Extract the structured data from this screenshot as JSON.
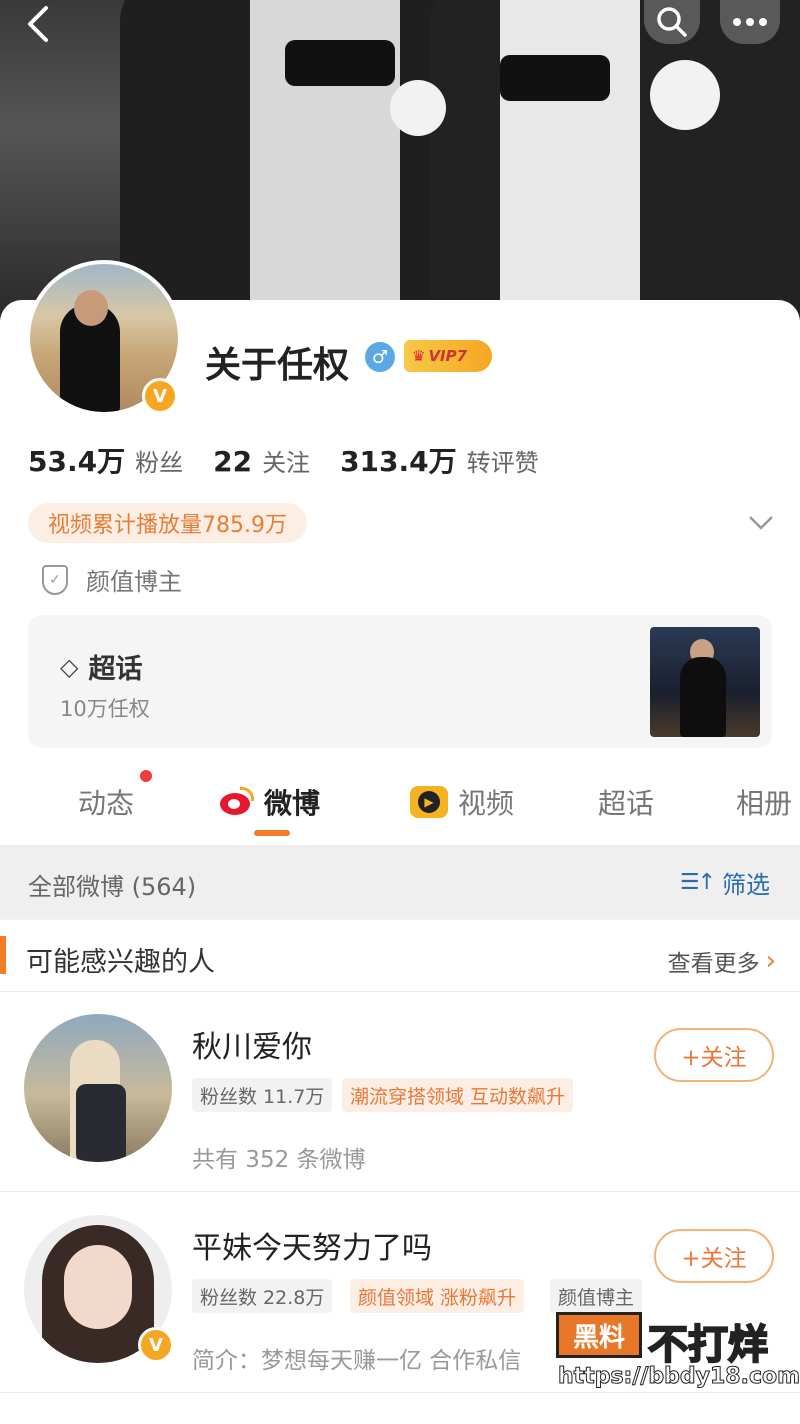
{
  "header": {
    "back_icon": "chevron-left-icon",
    "search_icon": "search-icon",
    "more_icon": "more-horizontal-icon"
  },
  "profile": {
    "name": "关于任权",
    "gender_symbol": "♂",
    "vip_label": "VIP7",
    "verified_badge": "V",
    "stats": [
      {
        "num": "53.4万",
        "label": "粉丝"
      },
      {
        "num": "22",
        "label": "关注"
      },
      {
        "num": "313.4万",
        "label": "转评赞"
      }
    ],
    "video_plays": "视频累计播放量785.9万",
    "tagline": "颜值博主",
    "accent_color": "#f47c27"
  },
  "supertopic": {
    "title": "超话",
    "subtitle": "10万任权"
  },
  "tabs": [
    {
      "label": "动态"
    },
    {
      "label": "微博"
    },
    {
      "label": "视频"
    },
    {
      "label": "超话"
    },
    {
      "label": "相册"
    }
  ],
  "filterbar": {
    "all_label": "全部微博 (564)",
    "filter_label": "筛选"
  },
  "recommendations": {
    "title": "可能感兴趣的人",
    "more_label": "查看更多",
    "people": [
      {
        "name": "秋川爱你",
        "fans": "粉丝数 11.7万",
        "tag": "潮流穿搭领域 互动数飙升",
        "desc": "共有 352 条微博",
        "follow_label": "+关注"
      },
      {
        "name": "平妹今天努力了吗",
        "fans": "粉丝数 22.8万",
        "tag": "颜值领域 涨粉飙升",
        "tag2": "颜值博主",
        "desc": "简介：梦想每天赚一亿 合作私信",
        "follow_label": "+关注",
        "verified_badge": "V"
      }
    ]
  },
  "watermark": {
    "box_text": "黑料",
    "text": "不打烊",
    "url": "https://bbdy18.com"
  }
}
